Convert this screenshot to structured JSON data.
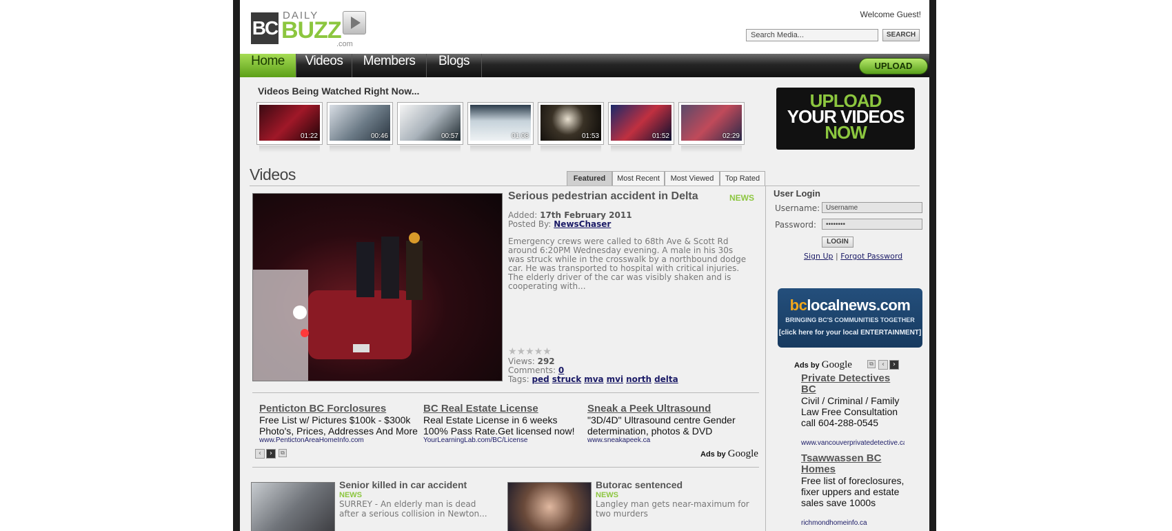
{
  "header": {
    "welcome": "Welcome Guest!",
    "search_placeholder": "Search Media...",
    "search_button": "SEARCH",
    "logo": {
      "bc": "BC",
      "daily": "DAILY",
      "buzz": "BUZZ",
      "com": ".com"
    }
  },
  "nav": {
    "items": [
      "Home",
      "Videos",
      "Members",
      "Blogs"
    ],
    "upload": "UPLOAD"
  },
  "watching": {
    "title": "Videos Being Watched Right Now...",
    "durations": [
      "01:22",
      "00:46",
      "00:57",
      "01:08",
      "01:53",
      "01:52",
      "02:29"
    ]
  },
  "upload_banner": {
    "line1": "UPLOAD",
    "line2": "YOUR VIDEOS",
    "line3": "NOW"
  },
  "videos": {
    "heading": "Videos",
    "tabs": [
      "Featured",
      "Most Recent",
      "Most Viewed",
      "Top Rated"
    ]
  },
  "featured": {
    "title": "Serious pedestrian accident in Delta",
    "category": "NEWS",
    "added_label": "Added:",
    "added": "17th February 2011",
    "posted_label": "Posted By:",
    "posted_by": "NewsChaser",
    "description": "Emergency crews were called to 68th Ave & Scott Rd around 6:20PM Wednesday evening. A male in his 30s was struck while in the crosswalk by a northbound dodge car. He was transported to hospital with critical injuries. The elderly driver of the car was visibly shaken and is cooperating with...",
    "views_label": "Views:",
    "views": "292",
    "comments_label": "Comments:",
    "comments": "0",
    "tags_label": "Tags:",
    "tags": [
      "ped",
      "struck",
      "mva",
      "mvi",
      "north",
      "delta"
    ]
  },
  "ads": [
    {
      "title": "Penticton BC Forclosures",
      "text": "Free List w/ Pictures $100k - $300k Photo's, Prices, Addresses And More",
      "url": "www.PentictonAreaHomeInfo.com"
    },
    {
      "title": "BC Real Estate License",
      "text": "Real Estate License in 6 weeks 100% Pass Rate.Get licensed now!",
      "url": "YourLearningLab.com/BC/License"
    },
    {
      "title": "Sneak a Peek Ultrasound",
      "text": "\"3D/4D\" Ultrasound centre Gender determination, photos & DVD",
      "url": "www.sneakapeek.ca"
    }
  ],
  "adsby": {
    "label": "Ads by",
    "brand": "Google"
  },
  "stories": [
    {
      "title": "Senior killed in car accident",
      "category": "NEWS",
      "text": "SURREY - An elderly man is dead after a serious collision in Newton..."
    },
    {
      "title": "Butorac sentenced",
      "category": "NEWS",
      "text": "Langley man gets near-maximum for two murders"
    }
  ],
  "login": {
    "heading": "User Login",
    "username_label": "Username:",
    "username_value": "Username",
    "password_label": "Password:",
    "password_value": "••••••••",
    "button": "LOGIN",
    "signup": "Sign Up",
    "separator": "|",
    "forgot": "Forgot Password"
  },
  "bclocalnews": {
    "brand_a": "bc",
    "brand_b": "localnews.com",
    "tagline": "BRINGING BC'S COMMUNITIES TOGETHER",
    "link": "[click here for your local ENTERTAINMENT]"
  },
  "side_ads": [
    {
      "title": "Private Detectives BC",
      "text": "Civil / Criminal / Family Law Free Consultation call 604-288-0545",
      "url": "www.vancouverprivatedetective.ca"
    },
    {
      "title": "Tsawwassen BC Homes",
      "text": "Free list of foreclosures, fixer uppers and estate sales save 1000s",
      "url": "richmondhomeinfo.ca"
    }
  ]
}
